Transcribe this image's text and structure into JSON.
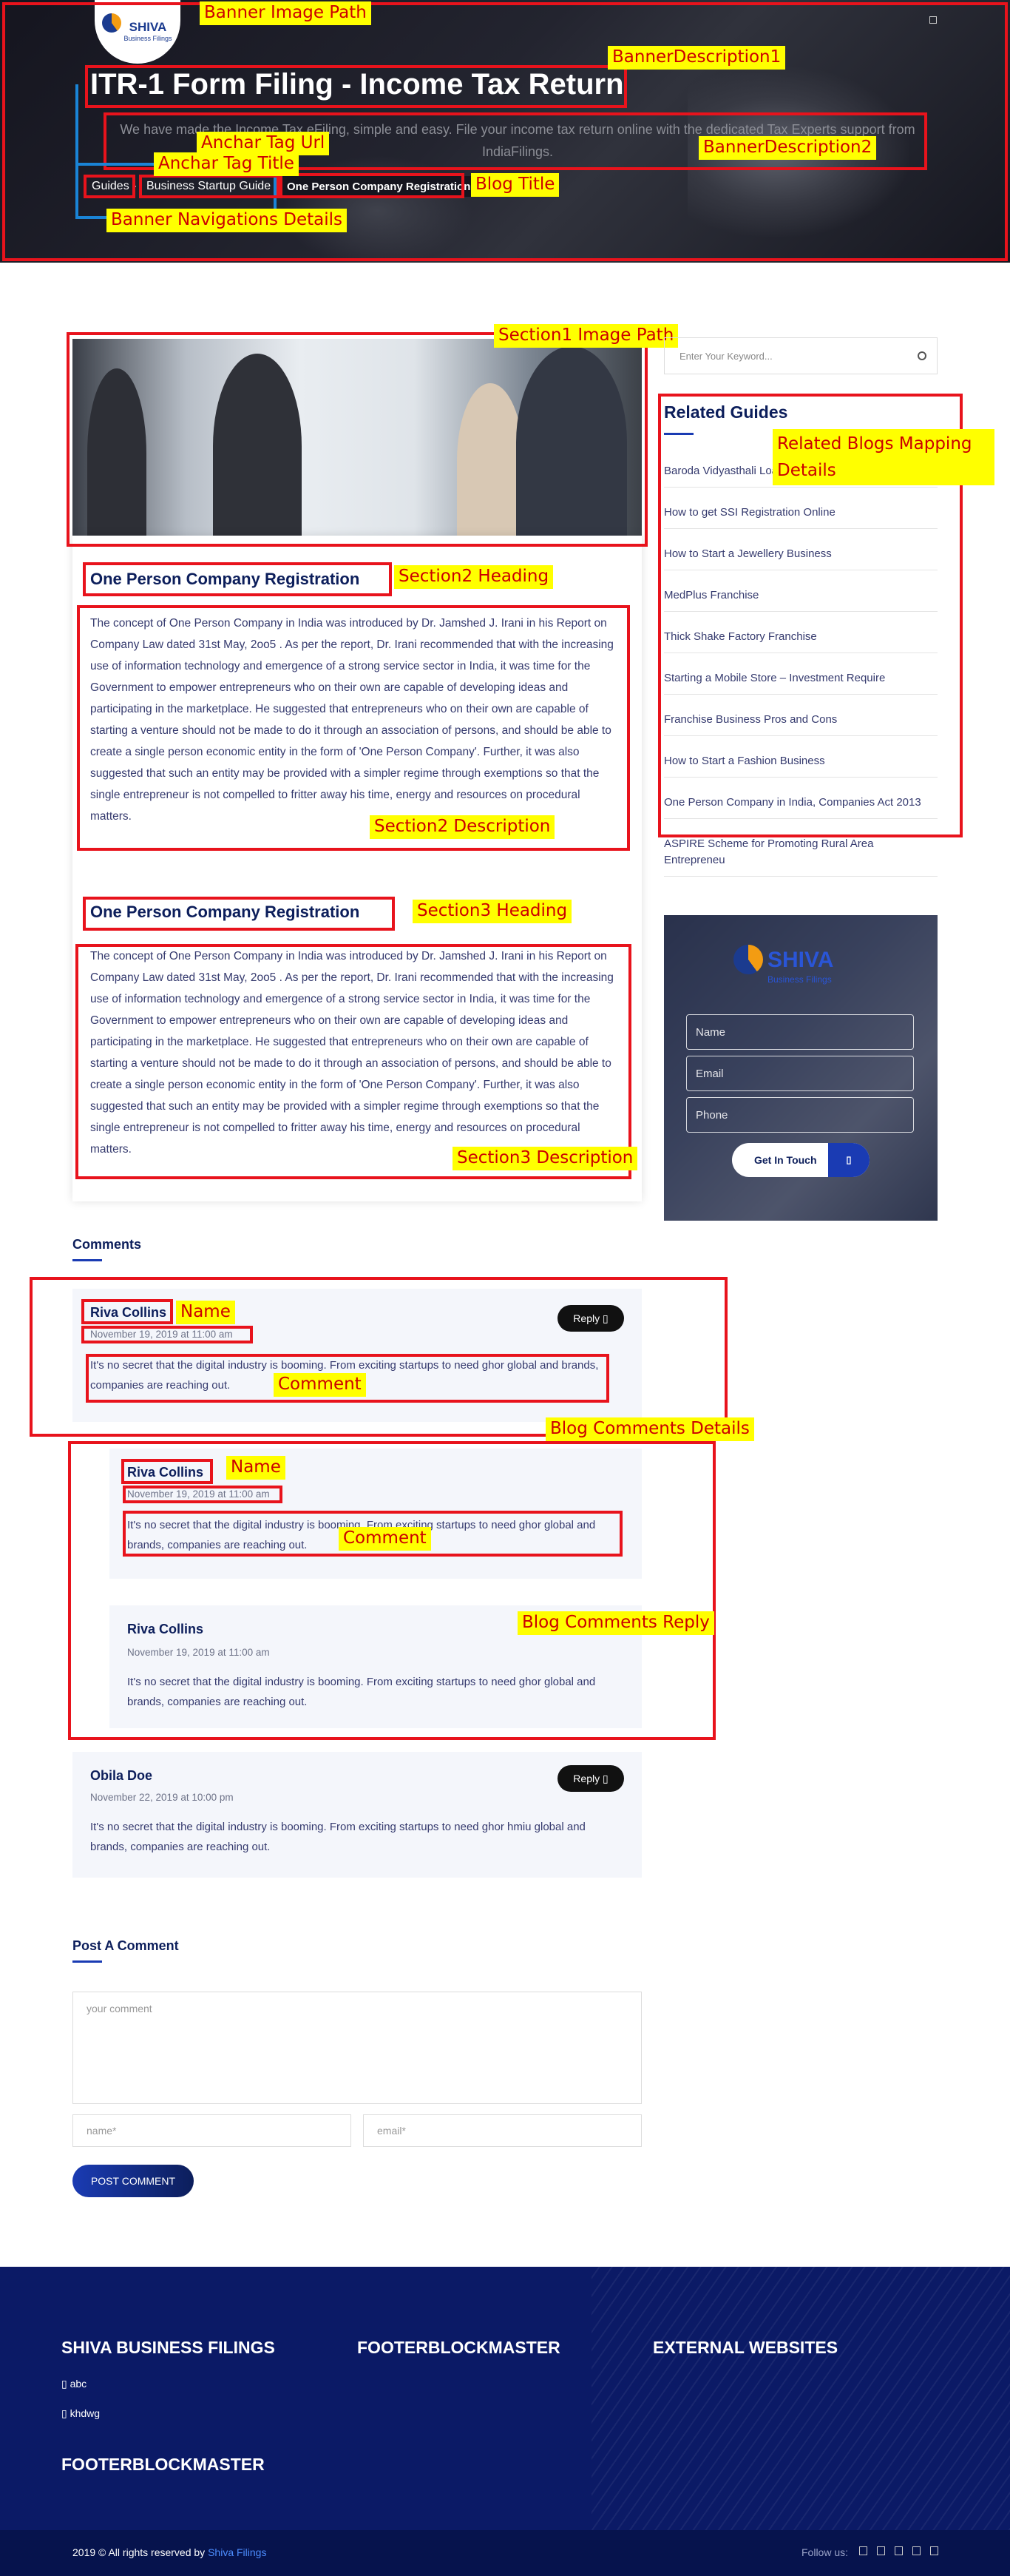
{
  "banner": {
    "logo_name": "SHIVA",
    "logo_tagline": "Business Filings",
    "title": "ITR-1 Form Filing - Income Tax Return",
    "description": "We have made the Income Tax eFiling, simple and easy. File your income tax return online with the dedicated Tax Experts support from IndiaFilings.",
    "breadcrumbs": [
      "Guides",
      "Business Startup Guide",
      "One Person Company Registration"
    ]
  },
  "annotations": {
    "banner_image_path": "Banner Image Path",
    "banner_description1": "BannerDescription1",
    "banner_description2": "BannerDescription2",
    "anchar_tag_url": "Anchar Tag Url",
    "anchar_tag_title": "Anchar Tag Title",
    "blog_title": "Blog Title",
    "banner_nav_details": "Banner Navigations Details",
    "section1_image_path": "Section1 Image Path",
    "related_blogs_mapping": "Related Blogs Mapping Details",
    "section2_heading": "Section2 Heading",
    "section2_description": "Section2 Description",
    "section3_heading": "Section3 Heading",
    "section3_description": "Section3 Description",
    "name1": "Name",
    "comment1": "Comment",
    "blog_comments_details": "Blog Comments Details",
    "name2": "Name",
    "comment2": "Comment",
    "blog_comments_reply": "Blog Comments Reply"
  },
  "section2": {
    "heading": "One Person Company Registration",
    "text": "The concept of One Person Company in India was introduced by Dr. Jamshed J. Irani in his Report on Company Law dated 31st May, 2oo5 . As per the report, Dr. Irani recommended that with the increasing use of information technology and emergence of a strong service sector in India, it was time for the Government to empower entrepreneurs who on their own are capable of developing ideas and participating in the marketplace. He suggested that entrepreneurs who on their own are capable of starting a venture should not be made to do it through an association of persons, and should be able to create a single person economic entity in the form of 'One Person Company'. Further, it was also suggested that such an entity may be provided with a simpler regime through exemptions so that the single entrepreneur is not compelled to fritter away his time, energy and resources on procedural matters."
  },
  "section3": {
    "heading": "One Person Company Registration",
    "text": "The concept of One Person Company in India was introduced by Dr. Jamshed J. Irani in his Report on Company Law dated 31st May, 2oo5 . As per the report, Dr. Irani recommended that with the increasing use of information technology and emergence of a strong service sector in India, it was time for the Government to empower entrepreneurs who on their own are capable of developing ideas and participating in the marketplace. He suggested that entrepreneurs who on their own are capable of starting a venture should not be made to do it through an association of persons, and should be able to create a single person economic entity in the form of 'One Person Company'. Further, it was also suggested that such an entity may be provided with a simpler regime through exemptions so that the single entrepreneur is not compelled to fritter away his time, energy and resources on procedural matters."
  },
  "sidebar": {
    "search_placeholder": "Enter Your Keyword...",
    "related_title": "Related Guides",
    "related": [
      "Baroda Vidyasthali Loan",
      "How to get SSI Registration Online",
      "How to Start a Jewellery Business",
      "MedPlus Franchise",
      "Thick Shake Factory Franchise",
      "Starting a Mobile Store – Investment Require",
      "Franchise Business Pros and Cons",
      "How to Start a Fashion Business",
      "One Person Company in India, Companies Act 2013",
      "ASPIRE Scheme for Promoting Rural Area Entrepreneu"
    ],
    "promo_logo": "SHIVA",
    "promo_tagline": "Business Filings",
    "name_placeholder": "Name",
    "email_placeholder": "Email",
    "phone_placeholder": "Phone",
    "get_in_touch": "Get In Touch"
  },
  "comments": {
    "title": "Comments",
    "reply_label": "Reply",
    "items": [
      {
        "name": "Riva Collins",
        "date": "November 19, 2019 at 11:00 am",
        "text": "It's no secret that the digital industry is booming. From exciting startups to need ghor global and brands, companies are reaching out."
      },
      {
        "name": "Riva Collins",
        "date": "November 19, 2019 at 11:00 am",
        "text": "It's no secret that the digital industry is booming. From exciting startups to need ghor global and brands, companies are reaching out."
      },
      {
        "name": "Riva Collins",
        "date": "November 19, 2019 at 11:00 am",
        "text": "It's no secret that the digital industry is booming. From exciting startups to need ghor global and brands, companies are reaching out."
      },
      {
        "name": "Obila Doe",
        "date": "November 22, 2019 at 10:00 pm",
        "text": "It's no secret that the digital industry is booming. From exciting startups to need ghor hmiu global and brands, companies are reaching out."
      }
    ]
  },
  "post_comment": {
    "title": "Post A Comment",
    "comment_placeholder": "your comment",
    "name_placeholder": "name*",
    "email_placeholder": "email*",
    "button": "POST COMMENT"
  },
  "footer": {
    "col1_title": "SHIVA BUSINESS FILINGS",
    "col2_title": "FOOTERBLOCKMASTER",
    "col3_title": "EXTERNAL WEBSITES",
    "col1_links": [
      "abc",
      "khdwg"
    ],
    "col4_title": "FOOTERBLOCKMASTER",
    "copyright_prefix": "2019 © All rights reserved by ",
    "copyright_link": "Shiva Filings",
    "follow_us": "Follow us:"
  }
}
